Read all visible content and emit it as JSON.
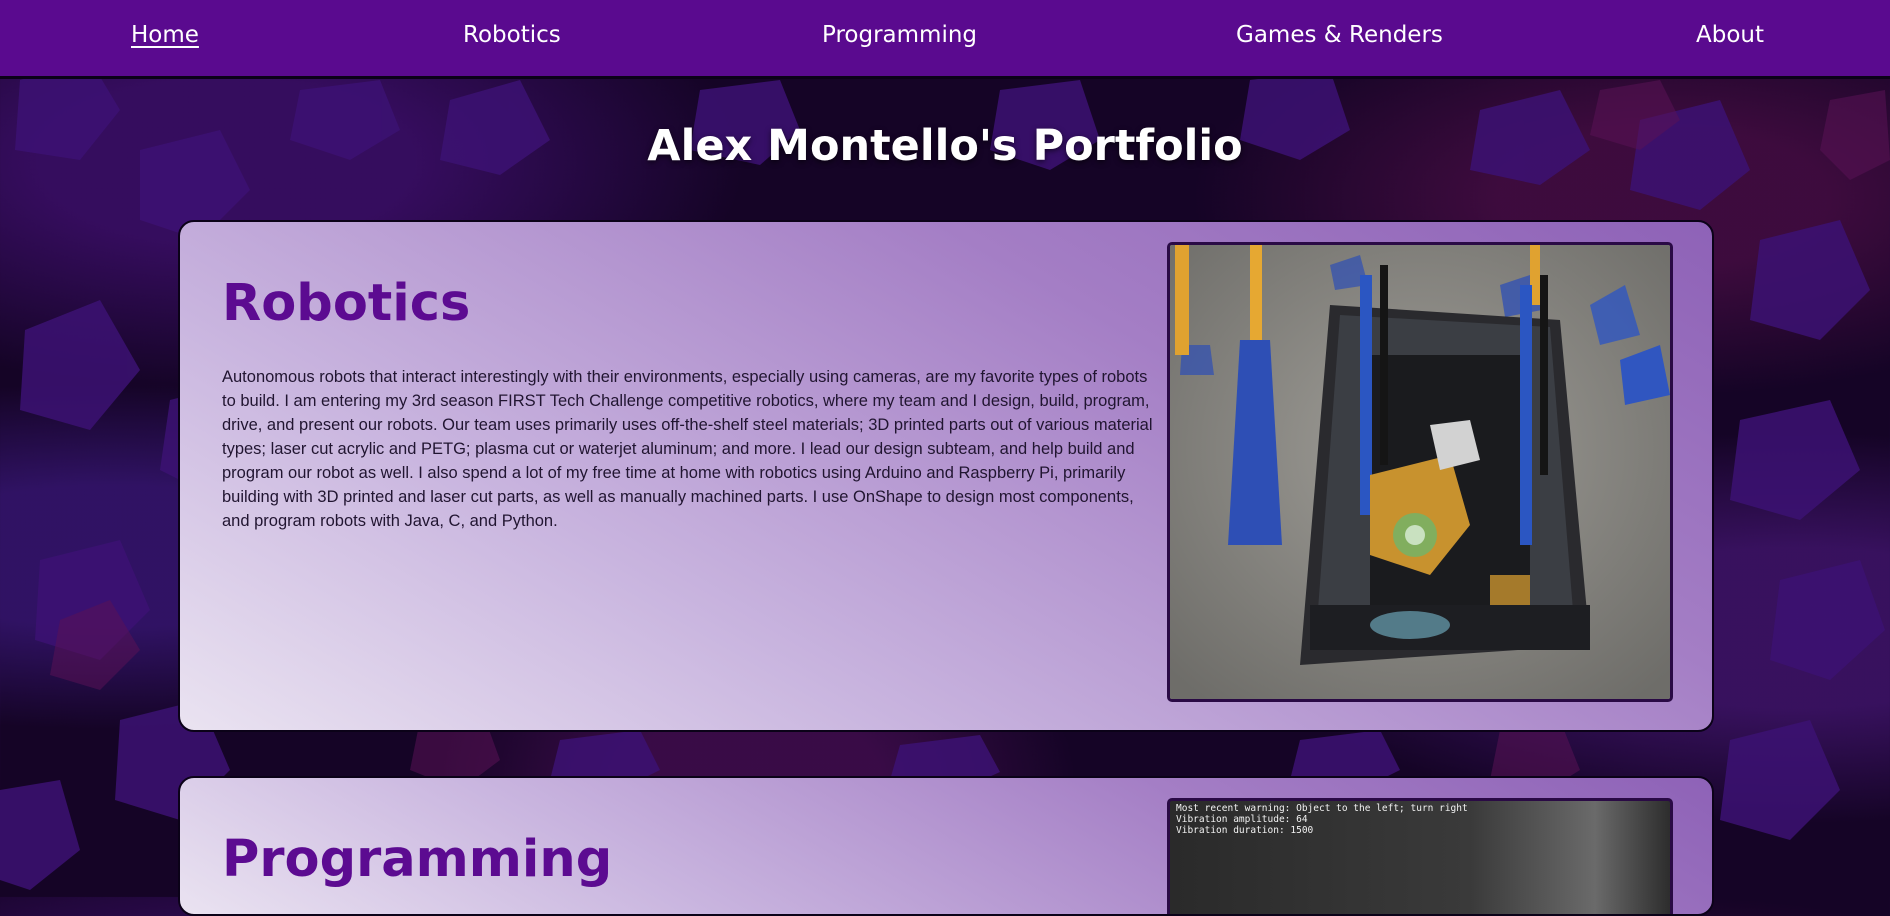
{
  "nav": {
    "items": [
      {
        "label": "Home",
        "active": true
      },
      {
        "label": "Robotics",
        "active": false
      },
      {
        "label": "Programming",
        "active": false
      },
      {
        "label": "Games & Renders",
        "active": false
      },
      {
        "label": "About",
        "active": false
      }
    ]
  },
  "page": {
    "title": "Alex Montello's Portfolio"
  },
  "sections": [
    {
      "heading": "Robotics",
      "body": "Autonomous robots that interact interestingly with their environments, especially using cameras, are my favorite types of robots to build. I am entering my 3rd season FIRST Tech Challenge competitive robotics, where my team and I design, build, program, drive, and present our robots. Our team uses primarily uses off-the-shelf steel materials; 3D printed parts out of various material types; laser cut acrylic and PETG; plasma cut or waterjet aluminum; and more. I lead our design subteam, and help build and program our robot as well. I also spend a lot of my free time at home with robotics using Arduino and Raspberry Pi, primarily building with 3D printed and laser cut parts, as well as manually machined parts. I use OnShape to design most components, and program robots with Java, C, and Python.",
      "image": "robot-photo"
    },
    {
      "heading": "Programming",
      "image": "console-screenshot",
      "console_lines": [
        "Most recent warning: Object to the left; turn right",
        "Vibration amplitude: 64",
        "Vibration duration: 1500"
      ]
    }
  ],
  "colors": {
    "nav_bg": "#5a0a8f",
    "heading": "#5c0b91",
    "page_bg": "#150426",
    "card_gradient_start": "#eae3f1",
    "card_gradient_end": "#8e62b7"
  }
}
